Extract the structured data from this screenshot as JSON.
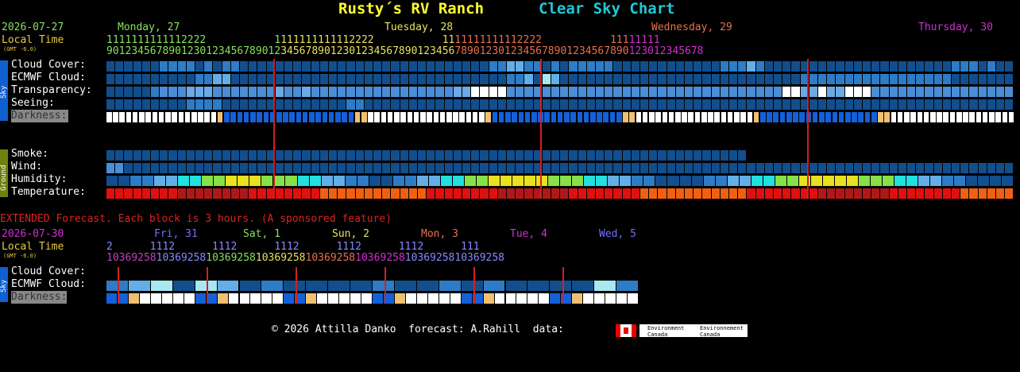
{
  "header": {
    "site_title": "Rusty´s RV Ranch",
    "chart_title": "Clear Sky Chart",
    "date": "2026-07-27",
    "local_time": "Local Time",
    "gmt": "(GMT -6.0)"
  },
  "days": [
    {
      "label": "Monday, 27",
      "color": "#88e060"
    },
    {
      "label": "Tuesday, 28",
      "color": "#e8e060"
    },
    {
      "label": "Wednesday, 29",
      "color": "#e87050"
    },
    {
      "label": "Thursday, 30",
      "color": "#d030d0"
    }
  ],
  "hour_tens": "1111111111112222           1111111111112222           1111111111112222           11111111",
  "hour_ones": "901234567890123012345678901234567890123012345678901234567890123012345678901234567890123012345678",
  "sky_labels": [
    "Cloud Cover:",
    "ECMWF Cloud:",
    "Transparency:",
    "Seeing:",
    "Darkness:"
  ],
  "ground_labels": [
    "Smoke:",
    "Wind:",
    "Humidity:",
    "Temperature:"
  ],
  "side_labels": {
    "sky": "Sky",
    "ground": "Ground"
  },
  "extended": {
    "note": "EXTENDED Forecast. Each block is 3 hours. (A sponsored feature)",
    "date": "2026-07-30",
    "local_time": "Local Time",
    "gmt": "(GMT -6.0)",
    "days": [
      {
        "label": "Fri, 31",
        "color": "#7070ff"
      },
      {
        "label": "Sat, 1",
        "color": "#88e060"
      },
      {
        "label": "Sun, 2",
        "color": "#e8e060"
      },
      {
        "label": "Mon, 3",
        "color": "#e87050"
      },
      {
        "label": "Tue, 4",
        "color": "#d030d0"
      },
      {
        "label": "Wed, 5",
        "color": "#7070ff"
      }
    ],
    "hour_tens": "2      1112      1112      1112      1112      1112      111",
    "hour_ones": "1036925810369258103692581036925810369258103692581036925810369258",
    "labels": [
      "Cloud Cover:",
      "ECMWF Cloud:",
      "Darkness:"
    ]
  },
  "footer": {
    "credit": "© 2026 Attilla Danko  forecast: A.Rahill  data:",
    "logo_text_1": "Environment Canada",
    "logo_text_2": "Environnement Canada"
  },
  "chart_data": {
    "type": "heatmap",
    "block_hours": 1,
    "sky_rows": {
      "cloud_cover": "11111122221212211111111111111111111111111112233221212222211111111111122232111111111111111111111222121111111111111111111111",
      "ecmwf_cloud": "11111111112233111111111111111111111111111111122314311111111111111111111111111122222222222222222111111111111111111111111",
      "transparency": "22222344455544444445445444444444444444455666644444444444444444444444444444446655655666444444444444444444444444444444444",
      "seeing": "21222221133332222222222222233222222222222222111112222222222222222222222222111222222222222222222222222222222",
      "darkness": "WWWWWWWWWWWWWWWWWMDDDDDDDDDDDDDDDDDDDDMMWWWWWWWWWWWWWWWWWWMDDDDDDDDDDDDDDDDDDDDMMWWWWWWWWWWWWWWWWWWMDDDDDDDDDDDDDDDDDDMMWWWWWWWWWWWWWWWWWWW"
    },
    "ground_rows": {
      "smoke": "111111111111111111111111111111111111111111111111111111111111111111111111111111111111",
      "wind": "2211111111111111111111111111111111111111111111111111111111111111111111111111111111111111111111111111111",
      "humidity": "3344556677888777665544334455667788888777665544333344556677888887776655443333",
      "temperature": "3333333322222222333333334444444444443333333322222222333333334444444444443333333322222222333333334444444444"
    }
  }
}
